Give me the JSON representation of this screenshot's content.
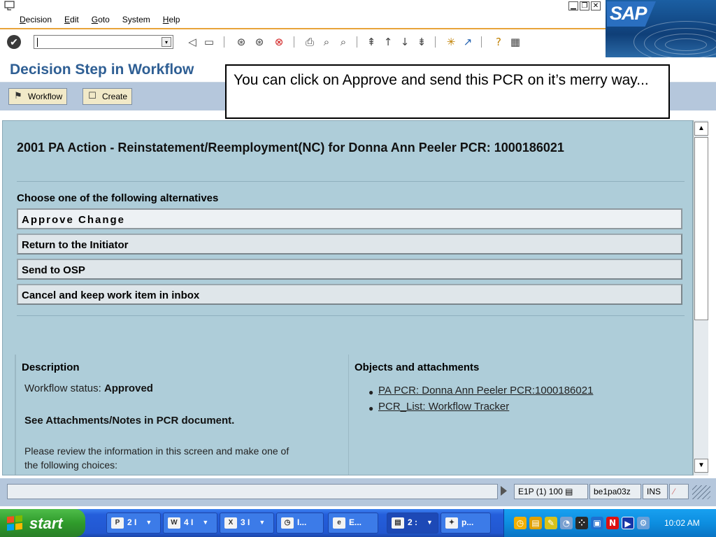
{
  "menu": {
    "items": [
      {
        "label": "Decision",
        "accel": "D",
        "rest": "ecision"
      },
      {
        "label": "Edit",
        "accel": "E",
        "rest": "dit"
      },
      {
        "label": "Goto",
        "accel": "G",
        "rest": "oto"
      },
      {
        "label": "System",
        "accel": "",
        "rest": "System"
      },
      {
        "label": "Help",
        "accel": "H",
        "rest": "elp"
      }
    ]
  },
  "window": {
    "minimize": "▁",
    "restore": "❐",
    "close": "✕"
  },
  "sap_logo": "SAP",
  "toolbar": {
    "command_value": ""
  },
  "title": "Decision Step in Workflow",
  "app_toolbar": {
    "workflow_label": "Workflow",
    "create_label": "Create"
  },
  "callout": "You can click on Approve and send this PCR on it’s merry way...",
  "content": {
    "heading": "2001 PA Action - Reinstatement/Reemployment(NC) for Donna Ann Peeler PCR: 1000186021",
    "choose_label": "Choose one of the following alternatives",
    "alternatives": [
      {
        "label": "Approve Change"
      },
      {
        "label": "Return to the Initiator"
      },
      {
        "label": "Send to OSP"
      },
      {
        "label": "Cancel and keep work item in inbox"
      }
    ],
    "description": {
      "title": "Description",
      "status_label": "Workflow status:",
      "status_value": "Approved",
      "note": "See Attachments/Notes in PCR document.",
      "instructions_1": "Please review the information in this screen and make one of",
      "instructions_2": "the following choices:"
    },
    "objects": {
      "title": "Objects and attachments",
      "items": [
        {
          "label": "PA PCR: Donna Ann Peeler PCR:1000186021"
        },
        {
          "label": "PCR_List: Workflow Tracker"
        }
      ]
    }
  },
  "statusbar": {
    "system": "E1P (1) 100",
    "server": "be1pa03z",
    "mode": "INS"
  },
  "taskbar": {
    "start_label": "start",
    "tasks": [
      {
        "icon": "P",
        "label": "2 I"
      },
      {
        "icon": "W",
        "label": "4 I"
      },
      {
        "icon": "X",
        "label": "3 I"
      },
      {
        "icon": "◷",
        "label": "I..."
      },
      {
        "icon": "e",
        "label": "E..."
      },
      {
        "icon": "▤",
        "label": "2 :"
      },
      {
        "icon": "✦",
        "label": "p..."
      }
    ],
    "clock": "10:02 AM"
  }
}
